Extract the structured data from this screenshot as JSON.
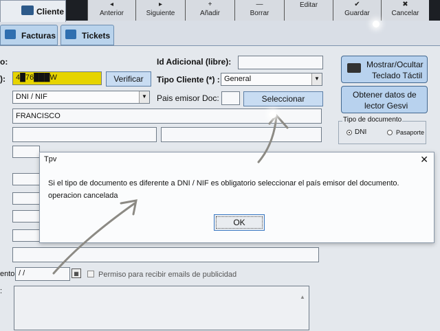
{
  "toolbar": {
    "tab_cliente": "Cliente",
    "buttons": [
      {
        "label": "Anterior",
        "icon": "◂"
      },
      {
        "label": "Siguiente",
        "icon": "▸"
      },
      {
        "label": "Añadir",
        "icon": "+"
      },
      {
        "label": "Borrar",
        "icon": "—"
      },
      {
        "label": "Editar",
        "icon": ""
      },
      {
        "label": "Guardar",
        "icon": "✔"
      },
      {
        "label": "Cancelar",
        "icon": "✖"
      }
    ]
  },
  "tabs": [
    {
      "label": "Facturas"
    },
    {
      "label": "Tickets"
    }
  ],
  "form": {
    "label_left_1": "o:",
    "label_left_2": "):",
    "doc_number": "4█76███W",
    "verificar_label": "Verificar",
    "id_adicional_label": "Id Adicional (libre):",
    "id_adicional_value": "",
    "tipo_cliente_label": "Tipo Cliente (*) :",
    "tipo_cliente_value": "General",
    "tipo_doc_value": "DNI / NIF",
    "pais_emisor_label": "Pais emisor Doc:",
    "pais_emisor_value": "",
    "seleccionar_label": "Seleccionar",
    "nombre_value": "FRANCISCO",
    "fecha_label": "ento:",
    "fecha_value": "/ /",
    "permiso_label": "Permiso para recibir emails de publicidad",
    "obs_label": ":"
  },
  "side": {
    "teclado_line1": "Mostrar/Ocultar",
    "teclado_line2": "Teclado Táctil",
    "gesvi_line1": "Obtener datos de",
    "gesvi_line2": "lector Gesvi",
    "tipo_doc_group": "Tipo de documento",
    "radio_dni": "DNI",
    "radio_pasaporte": "Pasaporte"
  },
  "dialog": {
    "title": "Tpv",
    "close": "✕",
    "line1": "Si el tipo de documento es diferente a DNI / NIF es obligatorio seleccionar el país emisor del documento.",
    "line2": "operacion cancelada",
    "ok": "OK"
  }
}
